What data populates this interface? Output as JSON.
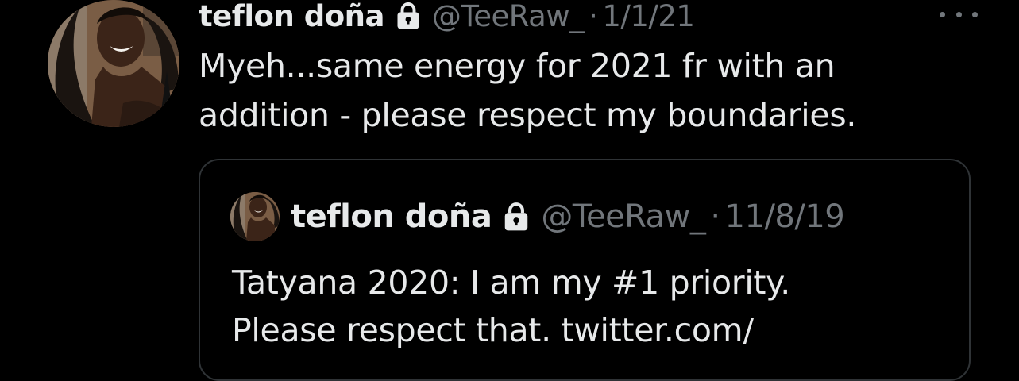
{
  "tweet": {
    "author": {
      "display_name": "teflon doña",
      "handle": "@TeeRaw_",
      "protected_icon": "lock-icon",
      "avatar": "profile-photo"
    },
    "separator": "·",
    "date": "1/1/21",
    "text_lines": [
      "Myeh...same energy for 2021 fr with an",
      "addition - please respect my boundaries."
    ],
    "more_icon": "more-horizontal-icon"
  },
  "quoted_tweet": {
    "author": {
      "display_name": "teflon doña",
      "handle": "@TeeRaw_",
      "protected_icon": "lock-icon",
      "avatar": "profile-photo"
    },
    "separator": "·",
    "date": "11/8/19",
    "text_lines": [
      "Tatyana 2020: I am my #1 priority.",
      "Please respect that. twitter.com/"
    ]
  },
  "colors": {
    "background": "#000000",
    "primary_text": "#e7e9ea",
    "secondary_text": "#71767b",
    "border": "#2f3336"
  }
}
